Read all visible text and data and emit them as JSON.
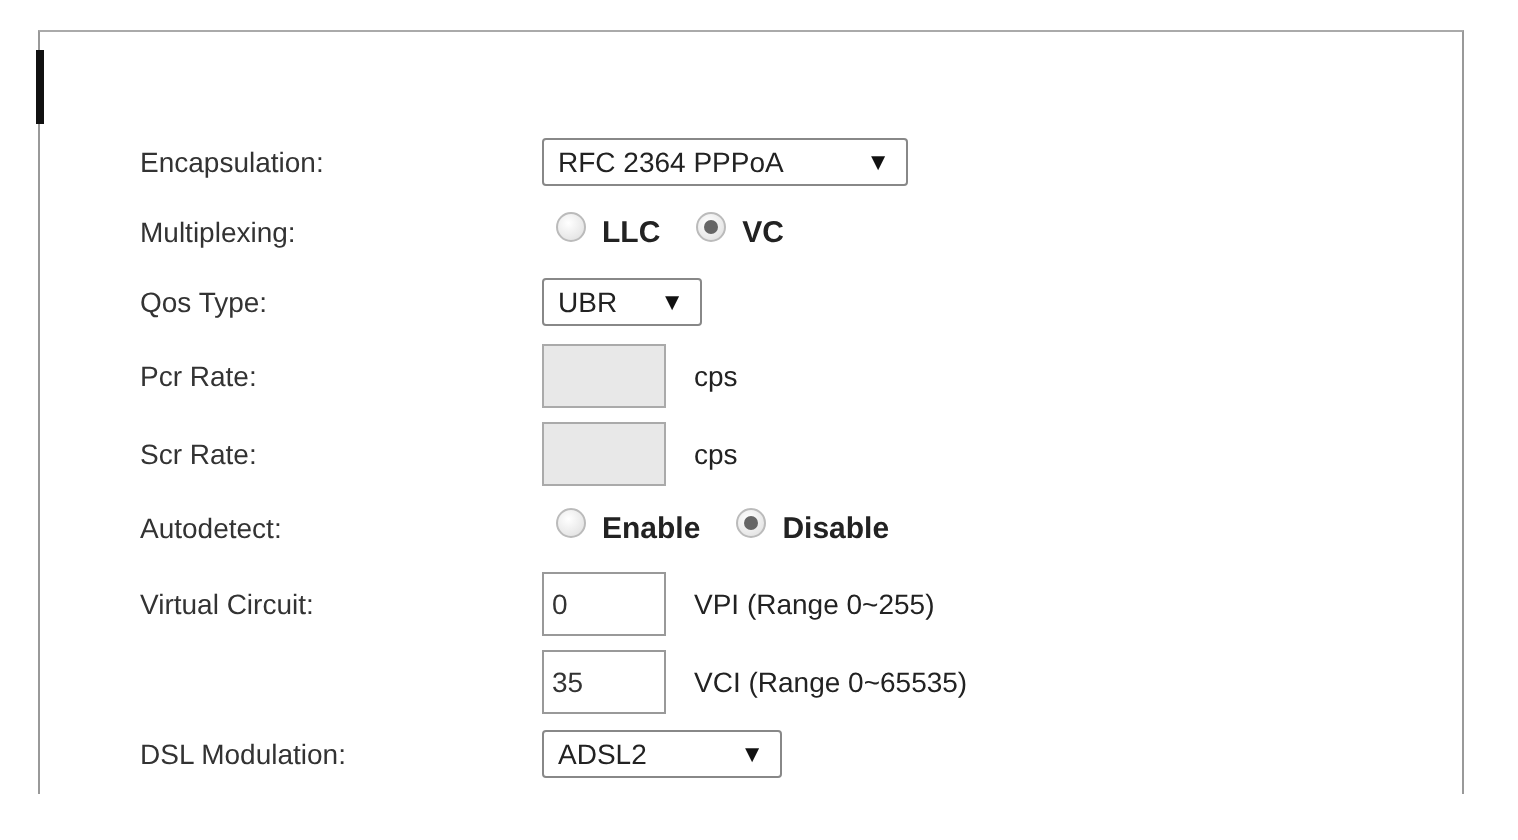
{
  "rows": [
    {
      "kind": "select",
      "label": "Encapsulation:",
      "value": "RFC 2364 PPPoA",
      "arrow": "▼"
    },
    {
      "kind": "radio",
      "label": "Multiplexing:",
      "options": [
        {
          "label": "LLC",
          "selected": false
        },
        {
          "label": "VC",
          "selected": true
        }
      ]
    },
    {
      "kind": "select",
      "label": "Qos Type:",
      "value": "UBR",
      "arrow": "▼"
    },
    {
      "kind": "input",
      "label": "Pcr Rate:",
      "disabled": true,
      "unit": "cps"
    },
    {
      "kind": "input",
      "label": "Scr Rate:",
      "disabled": true,
      "unit": "cps"
    },
    {
      "kind": "radio",
      "label": "Autodetect:",
      "options": [
        {
          "label": "Enable",
          "selected": false
        },
        {
          "label": "Disable",
          "selected": true
        }
      ]
    },
    {
      "kind": "input",
      "label": "Virtual Circuit:",
      "value": "0",
      "disabled": false,
      "unit": "VPI (Range 0~255)"
    },
    {
      "kind": "input",
      "value": "35",
      "disabled": false,
      "unit": "VCI (Range 0~65535)"
    },
    {
      "kind": "select",
      "label": "DSL Modulation:",
      "value": "ADSL2",
      "arrow": "▼"
    }
  ]
}
